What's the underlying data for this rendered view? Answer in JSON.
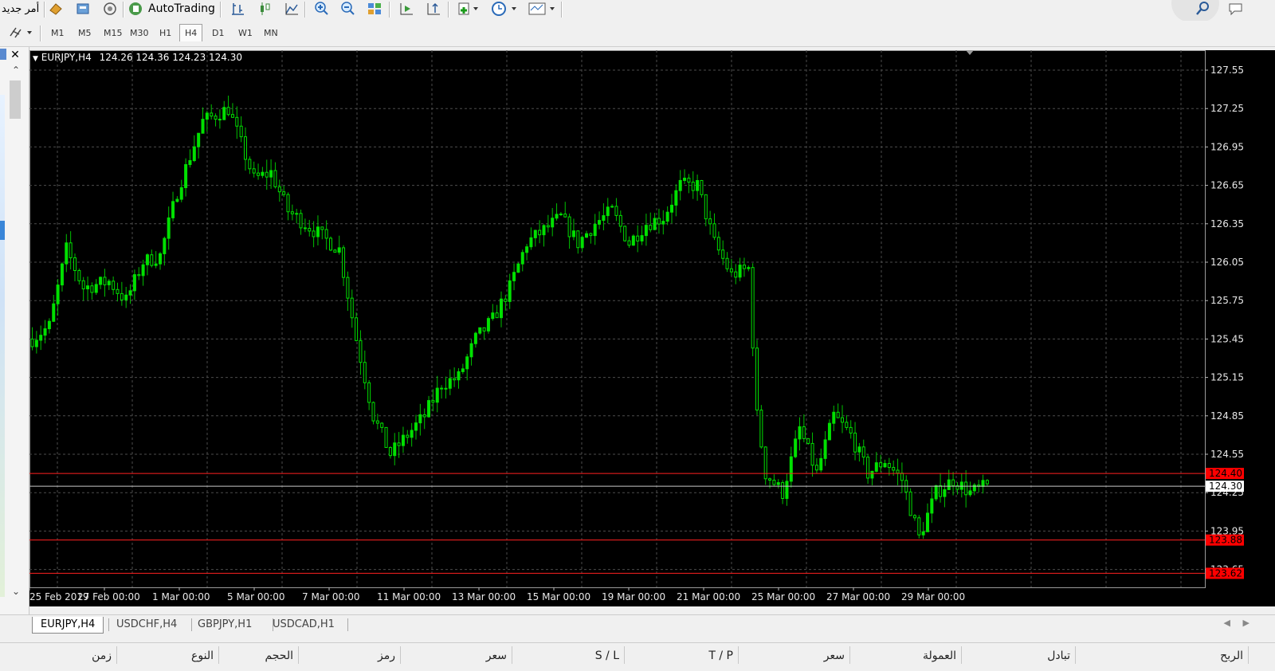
{
  "toolbar": {
    "new_order_label": "أمر جديد",
    "autotrading_label": "AutoTrading"
  },
  "timeframes": [
    "M1",
    "M5",
    "M15",
    "M30",
    "H1",
    "H4",
    "D1",
    "W1",
    "MN"
  ],
  "active_timeframe": "H4",
  "chart": {
    "title": "EURJPY,H4",
    "ohlc": "124.26 124.36 124.23 124.30",
    "price_axis": [
      "127.55",
      "127.25",
      "126.95",
      "126.65",
      "126.35",
      "126.05",
      "125.75",
      "125.45",
      "125.15",
      "124.85",
      "124.55",
      "124.25",
      "123.95",
      "123.65"
    ],
    "date_axis": [
      "25 Feb 2019",
      "27 Feb 00:00",
      "1 Mar 00:00",
      "5 Mar 00:00",
      "7 Mar 00:00",
      "11 Mar 00:00",
      "13 Mar 00:00",
      "15 Mar 00:00",
      "19 Mar 00:00",
      "21 Mar 00:00",
      "25 Mar 00:00",
      "27 Mar 00:00",
      "29 Mar 00:00"
    ],
    "hlines": [
      {
        "label": "124.40",
        "price": 124.4,
        "color": "#ff2020",
        "labelBg": "#ff0000",
        "labelColor": "#000"
      },
      {
        "label": "124.30",
        "price": 124.3,
        "color": "#c8c8c8",
        "labelBg": "#ffffff",
        "labelColor": "#000"
      },
      {
        "label": "123.88",
        "price": 123.88,
        "color": "#ff2020",
        "labelBg": "#ff0000",
        "labelColor": "#000"
      },
      {
        "label": "123.62",
        "price": 123.62,
        "color": "#ff2020",
        "labelBg": "#ff0000",
        "labelColor": "#000"
      }
    ],
    "colors": {
      "bg": "#000000",
      "grid": "#4c4c4c",
      "candle": "#00e000",
      "wick": "#00c000",
      "bearBody": "#000000"
    }
  },
  "tabs": [
    "EURJPY,H4",
    "USDCHF,H4",
    "GBPJPY,H1",
    "USDCAD,H1"
  ],
  "active_tab": "EURJPY,H4",
  "columns": [
    "الربح",
    "تبادل",
    "العمولة",
    "سعر",
    "T / P",
    "S / L",
    "سعر",
    "رمز",
    "الحجم",
    "النوع",
    "زمن"
  ]
}
